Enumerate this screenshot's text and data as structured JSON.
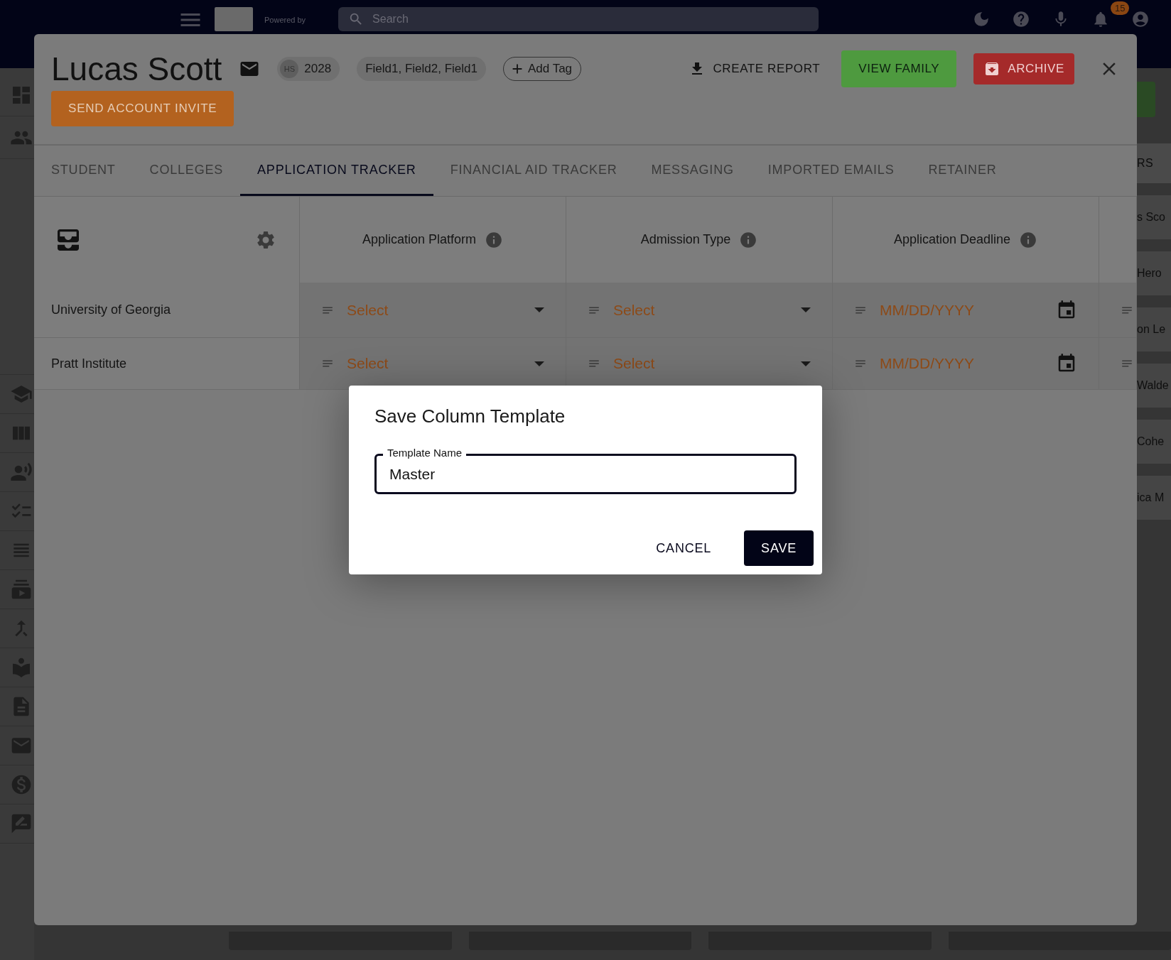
{
  "top_bar": {
    "powered_by": "Powered by",
    "search": {
      "placeholder": "Search"
    },
    "notifications": {
      "badge": "15"
    }
  },
  "background_list": {
    "header": "RS",
    "items": [
      "s Sco",
      "Hero",
      "on Le",
      "Walde",
      "Cohe",
      "ica M"
    ]
  },
  "student": {
    "name": "Lucas Scott",
    "grade": {
      "prefix": "HS",
      "year": "2028"
    },
    "tags": "Field1, Field2, Field1",
    "add_tag": "Add Tag",
    "send_invite": "SEND ACCOUNT INVITE",
    "actions": [
      {
        "kind": "report",
        "label": "CREATE REPORT"
      },
      {
        "kind": "family",
        "label": "VIEW FAMILY"
      },
      {
        "kind": "archive",
        "label": "ARCHIVE"
      }
    ]
  },
  "tabs": [
    {
      "label": "STUDENT",
      "selected": false
    },
    {
      "label": "COLLEGES",
      "selected": false
    },
    {
      "label": "APPLICATION TRACKER",
      "selected": true
    },
    {
      "label": "FINANCIAL AID TRACKER",
      "selected": false
    },
    {
      "label": "MESSAGING",
      "selected": false
    },
    {
      "label": "IMPORTED EMAILS",
      "selected": false
    },
    {
      "label": "RETAINER",
      "selected": false
    }
  ],
  "tracker": {
    "columns": [
      "Application Platform",
      "Admission Type",
      "Application Deadline"
    ],
    "rows": [
      {
        "college": "University of Georgia",
        "cells": [
          {
            "kind": "select",
            "placeholder": "Select"
          },
          {
            "kind": "select",
            "placeholder": "Select"
          },
          {
            "kind": "date",
            "placeholder": "MM/DD/YYYY"
          }
        ]
      },
      {
        "college": "Pratt Institute",
        "cells": [
          {
            "kind": "select",
            "placeholder": "Select"
          },
          {
            "kind": "select",
            "placeholder": "Select"
          },
          {
            "kind": "date",
            "placeholder": "MM/DD/YYYY"
          }
        ]
      }
    ]
  },
  "dialog": {
    "title": "Save Column Template",
    "field": {
      "label": "Template Name",
      "value": "Master"
    },
    "buttons": [
      {
        "kind": "text",
        "label": "CANCEL"
      },
      {
        "kind": "primary",
        "label": "SAVE"
      }
    ]
  }
}
